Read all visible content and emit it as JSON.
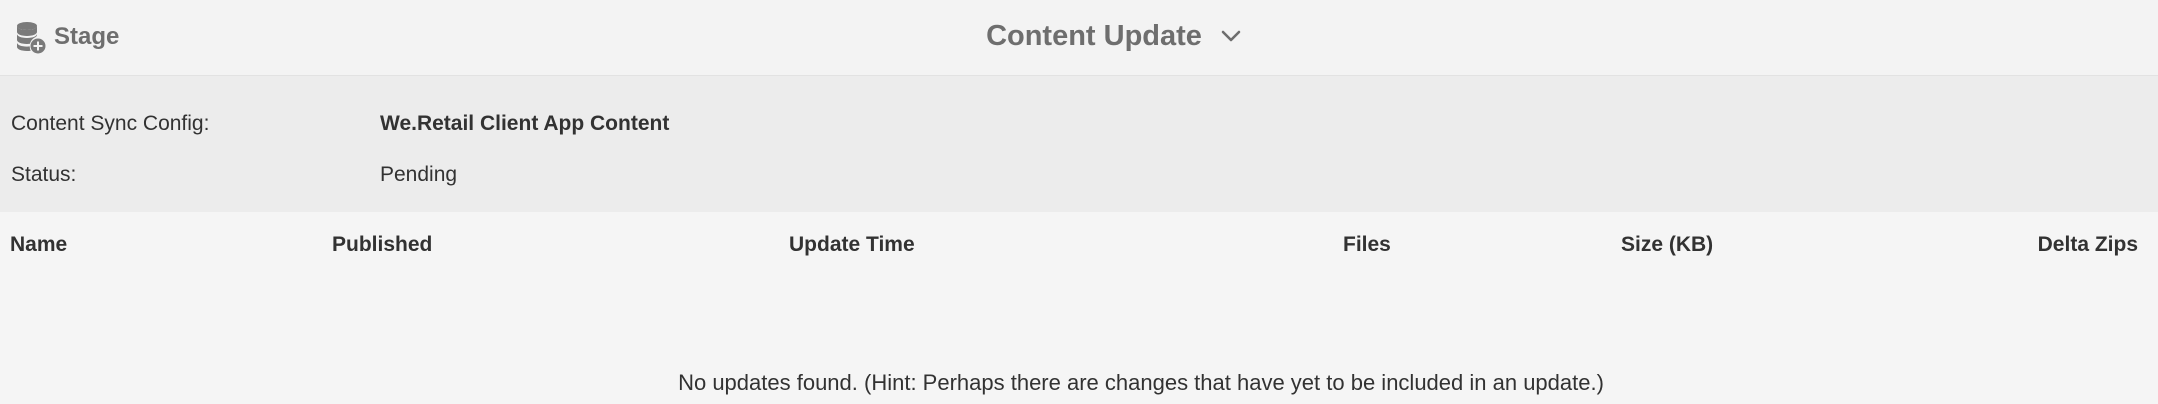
{
  "header": {
    "stage_label": "Stage",
    "stage_icon": "database-add-icon",
    "title": "Content Update",
    "title_icon": "chevron-down-icon"
  },
  "info": {
    "config_label": "Content Sync Config:",
    "config_value": "We.Retail Client App Content",
    "status_label": "Status:",
    "status_value": "Pending"
  },
  "table": {
    "columns": [
      "Name",
      "Published",
      "Update Time",
      "Files",
      "Size (KB)",
      "Delta Zips"
    ],
    "empty_message": "No updates found. (Hint: Perhaps there are changes that have yet to be included in an update.)"
  },
  "colors": {
    "header_bg": "#f3f3f3",
    "info_bg": "#ececec",
    "table_bg": "#f5f5f5",
    "muted_text": "#6e6e6e",
    "text": "#323232"
  }
}
